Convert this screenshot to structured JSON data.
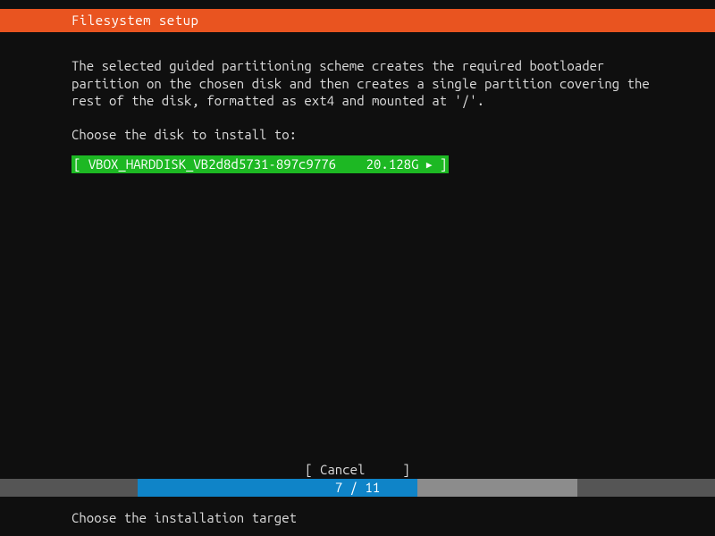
{
  "header": {
    "title": "Filesystem setup"
  },
  "main": {
    "description": "The selected guided partitioning scheme creates the required bootloader\npartition on the chosen disk and then creates a single partition covering the\nrest of the disk, formatted as ext4 and mounted at '/'.",
    "prompt": "Choose the disk to install to:",
    "disks": [
      {
        "label": "VBOX_HARDDISK_VB2d8d5731-897c9776",
        "size": "20.128G"
      }
    ]
  },
  "actions": {
    "cancel": "Cancel"
  },
  "progress": {
    "current": 7,
    "total": 11,
    "label": "7 / 11",
    "pct": 63.6
  },
  "footer": {
    "hint": "Choose the installation target"
  },
  "colors": {
    "accent": "#e95420",
    "select": "#1db823",
    "progress": "#0f84c8"
  }
}
